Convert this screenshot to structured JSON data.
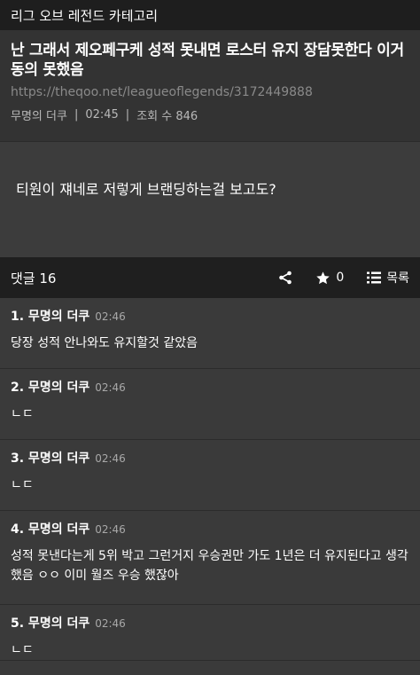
{
  "topbar": {
    "title": "리그 오브 레전드 카테고리"
  },
  "post": {
    "title": "난 그래서 제오페구케 성적 못내면 로스터 유지 장담못한다 이거 동의 못했음",
    "url": "https://theqoo.net/leagueoflegends/3172449888",
    "author": "무명의 더쿠",
    "time": "02:45",
    "views": "조회 수 846",
    "body": "티원이 쟤네로 저렇게 브랜딩하는걸 보고도?"
  },
  "comment_bar": {
    "title": "댓글 16",
    "share_icon": "share-icon",
    "star_icon": "star-icon",
    "star_count": "0",
    "list_icon": "list-icon",
    "list_label": "목록"
  },
  "comments": [
    {
      "num_author": "1. 무명의 더쿠",
      "time": "02:46",
      "text": "당장 성적 안나와도 유지할것 같았음"
    },
    {
      "num_author": "2. 무명의 더쿠",
      "time": "02:46",
      "text": "ㄴㄷ"
    },
    {
      "num_author": "3. 무명의 더쿠",
      "time": "02:46",
      "text": "ㄴㄷ"
    },
    {
      "num_author": "4. 무명의 더쿠",
      "time": "02:46",
      "text": "성적 못낸다는게 5위 박고 그런거지 우승권만 가도 1년은 더 유지된다고 생각했음 ㅇㅇ 이미 월즈 우승 했잖아"
    },
    {
      "num_author": "5. 무명의 더쿠",
      "time": "02:46",
      "text": "ㄴㄷ"
    }
  ]
}
